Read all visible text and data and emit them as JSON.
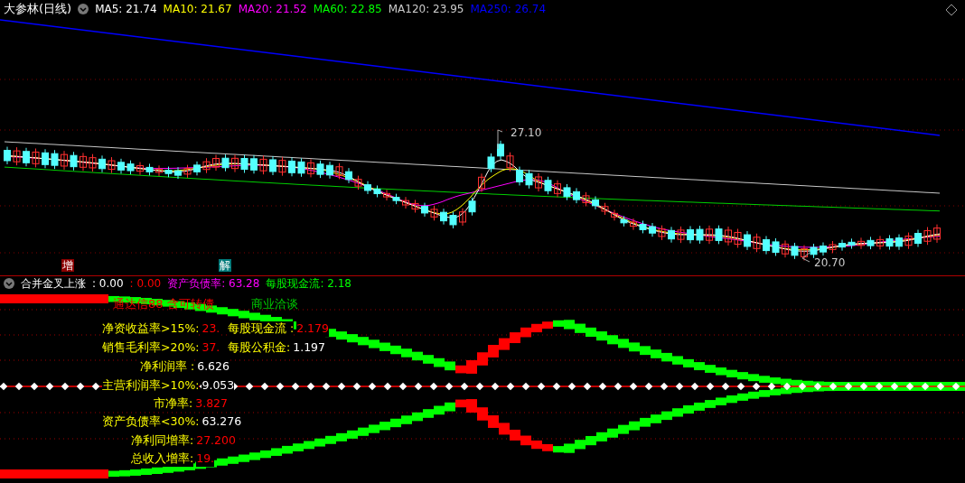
{
  "title": "大参林(日线)",
  "ma": [
    {
      "label": "MA5: 21.74",
      "color": "#ffffff"
    },
    {
      "label": "MA10: 21.67",
      "color": "#ffff00"
    },
    {
      "label": "MA20: 21.52",
      "color": "#ff00ff"
    },
    {
      "label": "MA60: 22.85",
      "color": "#00ff00"
    },
    {
      "label": "MA120: 23.95",
      "color": "#cccccc"
    },
    {
      "label": "MA250: 26.74",
      "color": "#0000ff"
    }
  ],
  "high_label": "27.10",
  "low_label": "20.70",
  "markers": [
    {
      "label": "增",
      "color": "#8b0000"
    },
    {
      "label": "解",
      "color": "#007a7a"
    }
  ],
  "indicator": {
    "name": "合并金叉上涨",
    "value_1": ": 0.00",
    "value_2": ": 0.00",
    "debt_ratio": "资产负债率: 63.28",
    "cash_flow": "每股现金流: 2.18"
  },
  "notes": [
    {
      "text": "通达信88 含可转债",
      "color": "#ff0000"
    },
    {
      "text": "商业洽谈",
      "color": "#00cc00"
    }
  ],
  "metrics": [
    {
      "label": "净资收益率>15%:",
      "value": "23.",
      "color": "#ff0000"
    },
    {
      "label": "每股现金流 :",
      "value": "2.179",
      "color": "#ff0000"
    },
    {
      "label": "销售毛利率>20%:",
      "value": "37.",
      "color": "#ff0000"
    },
    {
      "label": "每股公积金:",
      "value": "1.197",
      "color": "#ffffff"
    },
    {
      "label": "净利润率 :",
      "value": "6.626",
      "color": "#ffffff"
    },
    {
      "label": "主营利润率>10%:",
      "value": "9.053",
      "color": "#ffffff"
    },
    {
      "label": "市净率:",
      "value": "3.827",
      "color": "#ff0000"
    },
    {
      "label": "资产负债率<30%:",
      "value": "63.276",
      "color": "#ffffff"
    },
    {
      "label": "净利同增率:",
      "value": "27.200",
      "color": "#ff0000"
    },
    {
      "label": "总收入增率:",
      "value": "19.",
      "color": "#ff0000"
    }
  ]
}
